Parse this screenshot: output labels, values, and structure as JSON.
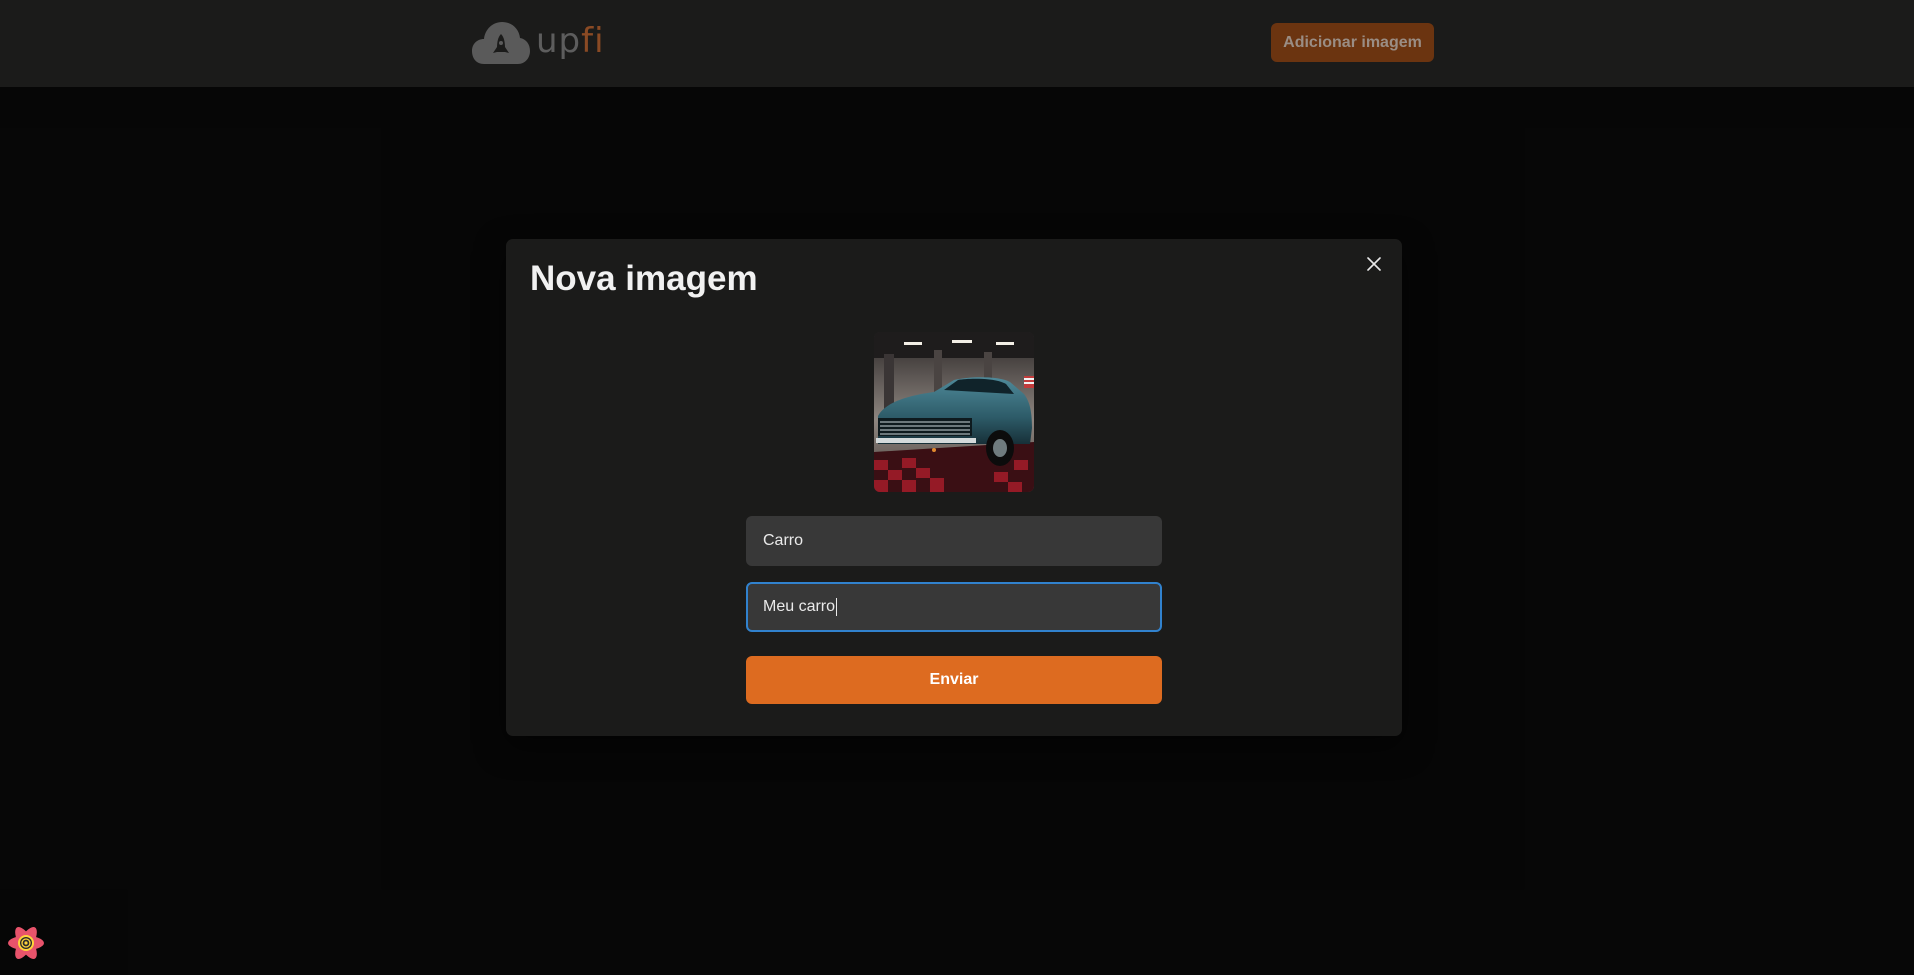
{
  "header": {
    "logo": {
      "text_up": "up",
      "text_fi": "fi",
      "icon": "cloud-rocket-icon"
    },
    "add_button_label": "Adicionar imagem"
  },
  "modal": {
    "title": "Nova imagem",
    "close_icon": "close-icon",
    "preview": {
      "subject": "blue classic car in garage"
    },
    "fields": {
      "title_value": "Carro",
      "description_value": "Meu carro"
    },
    "submit_label": "Enviar"
  },
  "devtools": {
    "icon": "react-query-devtools-icon"
  },
  "colors": {
    "accent": "#dd6b20",
    "focus_ring": "#3182ce",
    "background": "#0f0f0f",
    "surface": "#1b1b1a",
    "input_bg": "#383838"
  }
}
